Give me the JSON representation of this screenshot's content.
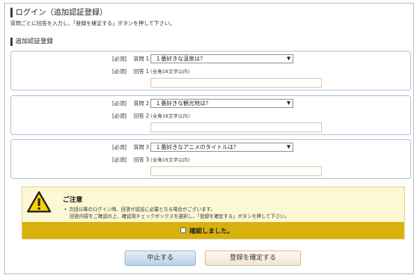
{
  "page": {
    "title": "ログイン（追加認証登録）",
    "instruction": "質問ごとに回答を入力し、「登録を確定する」ボタンを押して下さい。",
    "section_title": "追加認証登録"
  },
  "questions": [
    {
      "required": "[必須]",
      "question_label": "質問 1",
      "selected": "１番好きな温泉は？",
      "answer_label": "回答 1",
      "hint": "(全角16文字以内)",
      "answer_value": ""
    },
    {
      "required": "[必須]",
      "question_label": "質問 2",
      "selected": "１番好きな観光地は？",
      "answer_label": "回答 2",
      "hint": "(全角16文字以内)",
      "answer_value": ""
    },
    {
      "required": "[必須]",
      "question_label": "質問 3",
      "selected": "１番好きなアニメのタイトルは？",
      "answer_label": "回答 3",
      "hint": "(全角16文字以内)",
      "answer_value": ""
    }
  ],
  "notice": {
    "icon": "warning-triangle-icon",
    "title": "ご注意",
    "bullet": "•",
    "line1": "次回以降のログイン時、回答が認証に必要となる場合がございます。",
    "line2": "回答内容をご確認の上、確認用チェックボックスを選択し、「登録を確定する」ボタンを押して下さい。",
    "confirm_label": "確認しました。",
    "confirm_checked": false
  },
  "buttons": {
    "cancel": "中止する",
    "submit": "登録を確定する"
  },
  "colors": {
    "panel_border": "#a9c0d8",
    "notice_bg": "#fdf7d4",
    "confirm_bar": "#d8b10d",
    "answer_border": "#d8c3a0"
  }
}
